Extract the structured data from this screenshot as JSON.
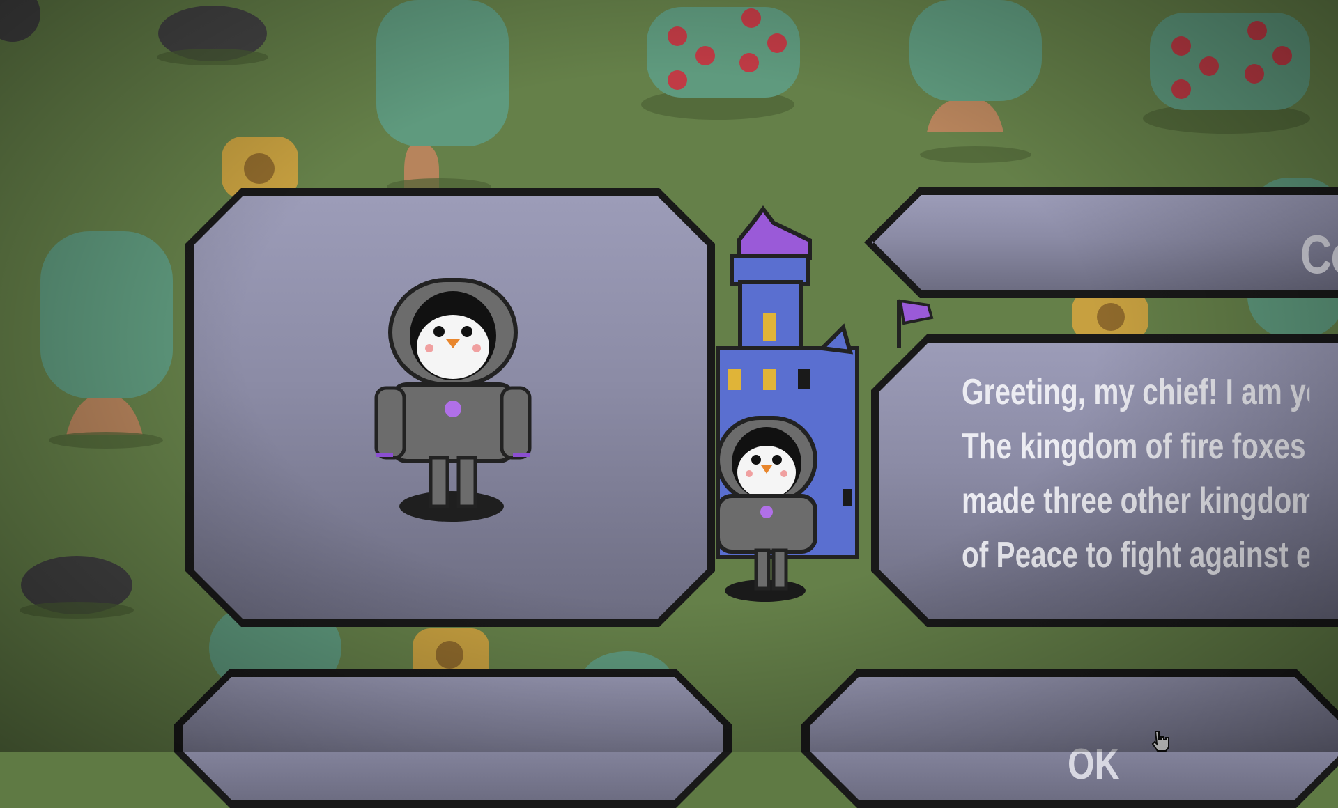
{
  "scene": {
    "name": "overworld-intro-dialog",
    "colors": {
      "grass": "#5f7a44",
      "panel_fill": "#8b8ba5",
      "panel_border": "#191919",
      "text": "#ececf2",
      "castle": "#5a6fd0",
      "castle_roof": "#9a5ad8"
    }
  },
  "dialog": {
    "speaker_name": "Co",
    "lines": [
      "Greeting, my chief! I am you",
      "The kingdom of fire foxes  j",
      "made three other kingdoms",
      "of Peace to fight against ea"
    ],
    "ok_label": "OK"
  },
  "icons": {
    "portrait": "penguin-astronaut-portrait",
    "player": "penguin-astronaut-player-icon",
    "castle": "castle-icon",
    "cursor": "hand-pointer-cursor-icon"
  }
}
